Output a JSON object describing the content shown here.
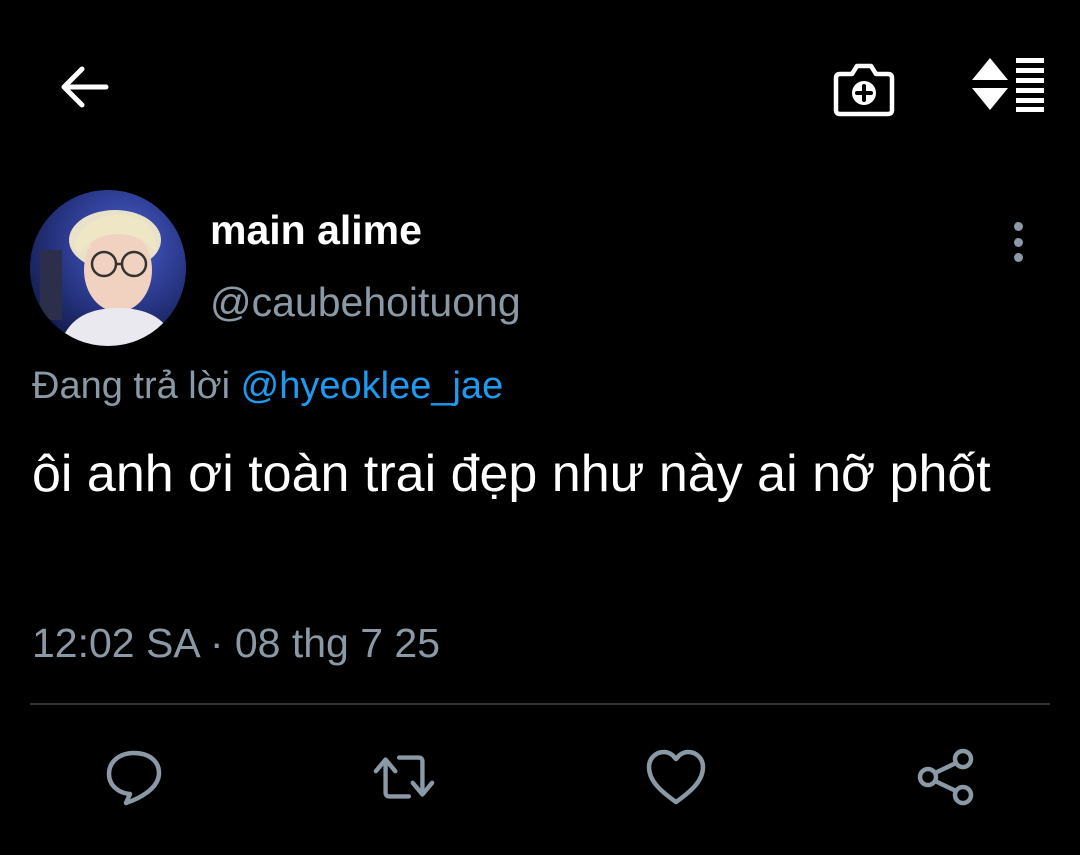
{
  "colors": {
    "background": "#000000",
    "text_primary": "#ffffff",
    "text_secondary": "#8b98a5",
    "link": "#1d9bf0",
    "divider": "#2f3336"
  },
  "toolbar": {
    "back_icon": "arrow-left-icon",
    "camera_icon": "camera-plus-icon",
    "sort_icon": "sort-toggle-icon"
  },
  "tweet": {
    "display_name": "main alime",
    "handle": "@caubehoituong",
    "reply_prefix": "Đang trả lời",
    "reply_to": "@hyeoklee_jae",
    "text": "ôi anh ơi toàn trai đẹp như này ai nỡ phốt",
    "timestamp": "12:02 SA · 08 thg 7 25"
  },
  "actions": [
    {
      "name": "reply",
      "icon": "comment-icon"
    },
    {
      "name": "retweet",
      "icon": "retweet-icon"
    },
    {
      "name": "like",
      "icon": "heart-icon"
    },
    {
      "name": "share",
      "icon": "share-icon"
    }
  ]
}
